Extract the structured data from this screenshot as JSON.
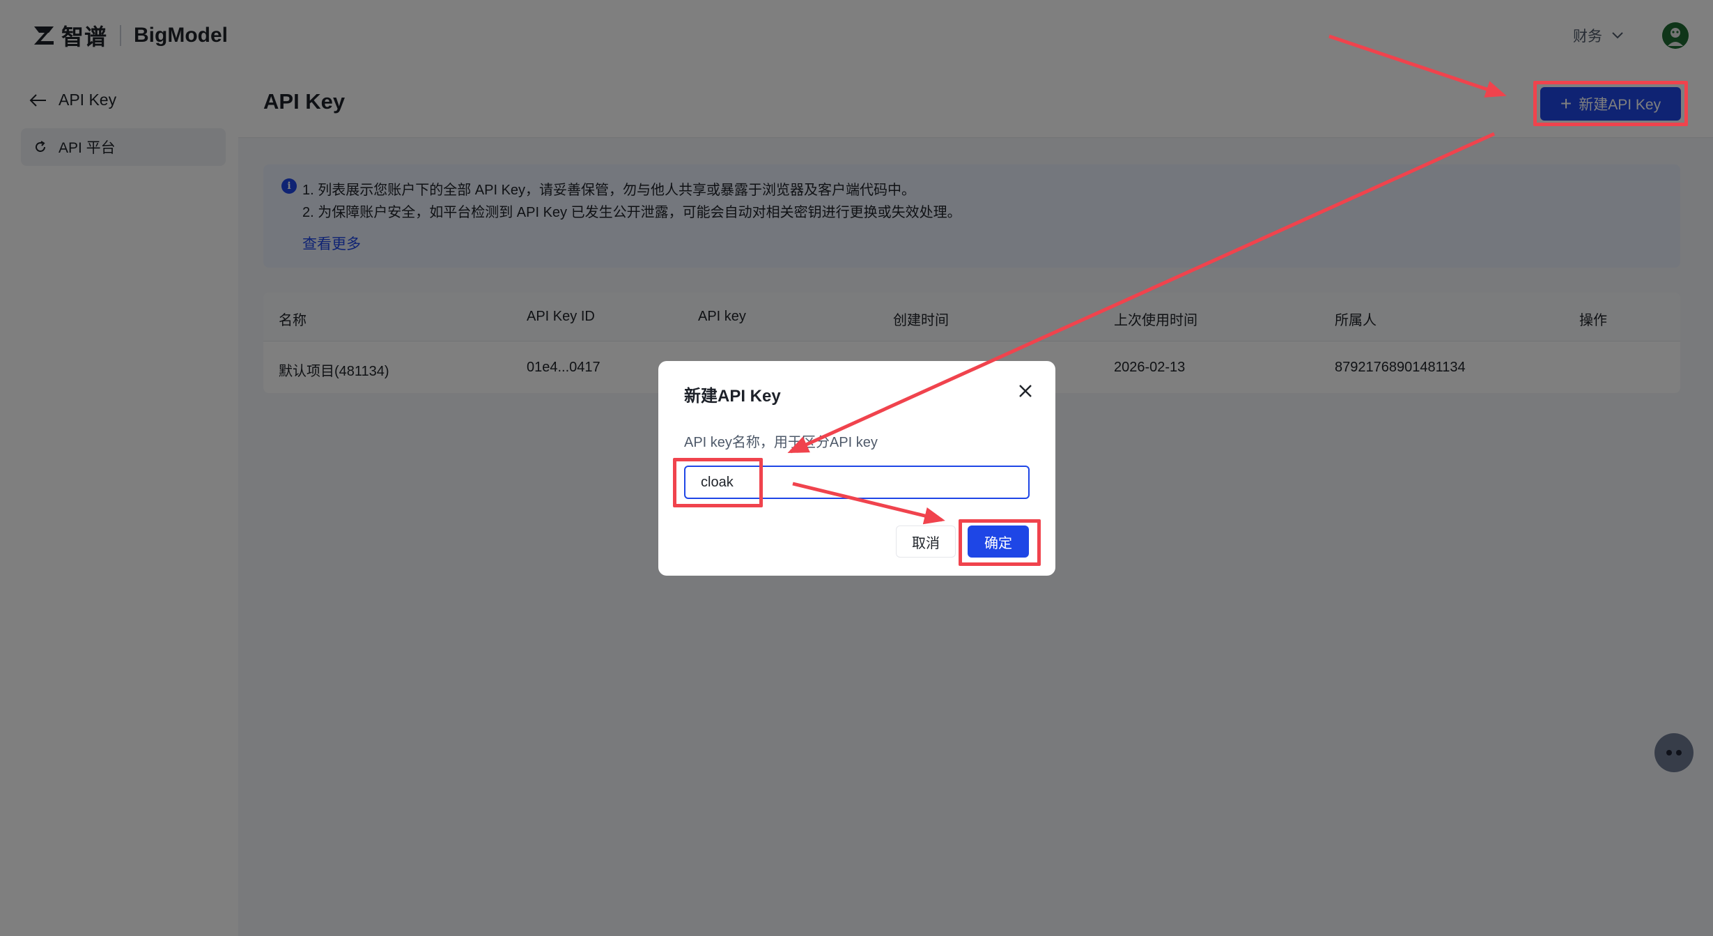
{
  "brand": {
    "cn": "智谱",
    "en": "BigModel"
  },
  "header": {
    "org": "财务"
  },
  "sidebar": {
    "back_label": "API Key",
    "items": [
      {
        "label": "API 平台"
      }
    ]
  },
  "page": {
    "title": "API Key",
    "new_button": "新建API Key",
    "notice": {
      "line1": "1. 列表展示您账户下的全部 API Key，请妥善保管，勿与他人共享或暴露于浏览器及客户端代码中。",
      "line2": "2. 为保障账户安全，如平台检测到 API Key 已发生公开泄露，可能会自动对相关密钥进行更换或失效处理。",
      "link": "查看更多"
    },
    "table": {
      "columns": [
        "名称",
        "API Key ID",
        "API key",
        "创建时间",
        "上次使用时间",
        "所属人",
        "操作"
      ],
      "rows": [
        {
          "name": "默认项目(481134)",
          "key_id": "01e4...0417",
          "api_key": "",
          "created": "",
          "last_used": "2026-02-13",
          "owner": "87921768901481134",
          "action": ""
        }
      ]
    }
  },
  "dialog": {
    "title": "新建API Key",
    "label": "API key名称，用于区分API key",
    "input_value": "cloak",
    "cancel": "取消",
    "confirm": "确定"
  },
  "colors": {
    "primary": "#1e46e6",
    "annotation": "#f0434d",
    "overlay": "rgba(0,0,0,0.5)"
  }
}
